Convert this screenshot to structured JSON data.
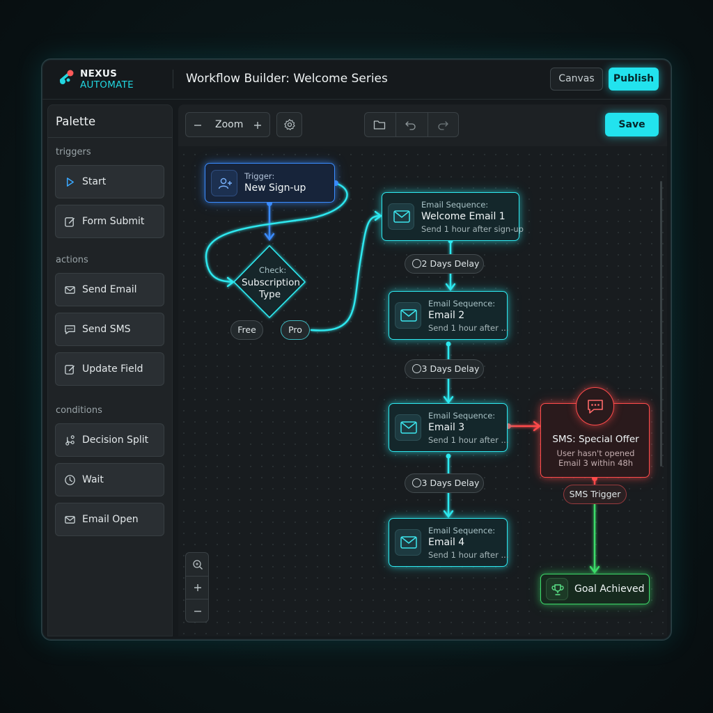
{
  "app": {
    "logo_line1": "NEXUS",
    "logo_line2": "AUTOMATE",
    "title": "Workflow Builder: Welcome Series"
  },
  "header_buttons": {
    "canvas": "Canvas",
    "publish": "Publish"
  },
  "palette": {
    "title": "Palette",
    "sections": [
      {
        "label": "triggers",
        "items": [
          {
            "label": "Start",
            "icon": "play-icon"
          },
          {
            "label": "Form Submit",
            "icon": "edit-icon"
          }
        ]
      },
      {
        "label": "actions",
        "items": [
          {
            "label": "Send Email",
            "icon": "mail-icon"
          },
          {
            "label": "Send SMS",
            "icon": "chat-icon"
          },
          {
            "label": "Update Field",
            "icon": "edit-icon"
          }
        ]
      },
      {
        "label": "conditions",
        "items": [
          {
            "label": "Decision Split",
            "icon": "split-icon"
          },
          {
            "label": "Wait",
            "icon": "clock-icon"
          },
          {
            "label": "Email Open",
            "icon": "mail-icon"
          }
        ]
      }
    ]
  },
  "toolbar": {
    "zoom_label": "Zoom",
    "save": "Save"
  },
  "nodes": {
    "trigger": {
      "kind": "Trigger:",
      "name": "New Sign-up"
    },
    "check": {
      "kind": "Check:",
      "line1": "Subscription",
      "line2": "Type",
      "free": "Free",
      "pro": "Pro"
    },
    "email1": {
      "kind": "Email Sequence:",
      "name": "Welcome Email 1",
      "desc": "Send 1 hour after sign-up"
    },
    "email2": {
      "kind": "Email Sequence:",
      "name": "Email 2",
      "desc": "Send 1 hour after ..."
    },
    "email3": {
      "kind": "Email Sequence:",
      "name": "Email 3",
      "desc": "Send 1 hour after ..."
    },
    "email4": {
      "kind": "Email Sequence:",
      "name": "Email 4",
      "desc": "Send 1 hour after ..."
    },
    "delay1": "2 Days Delay",
    "delay2": "3 Days Delay",
    "delay3": "3 Days Delay",
    "sms": {
      "name": "SMS: Special Offer",
      "desc1": "User hasn't opened",
      "desc2": "Email 3 within 48h",
      "trigger": "SMS Trigger"
    },
    "goal": "Goal Achieved"
  },
  "colors": {
    "accent": "#22e3ee",
    "trigger": "#3a8cff",
    "sms": "#ff4b4b",
    "goal": "#3ddc6a",
    "background": "#15191c"
  }
}
